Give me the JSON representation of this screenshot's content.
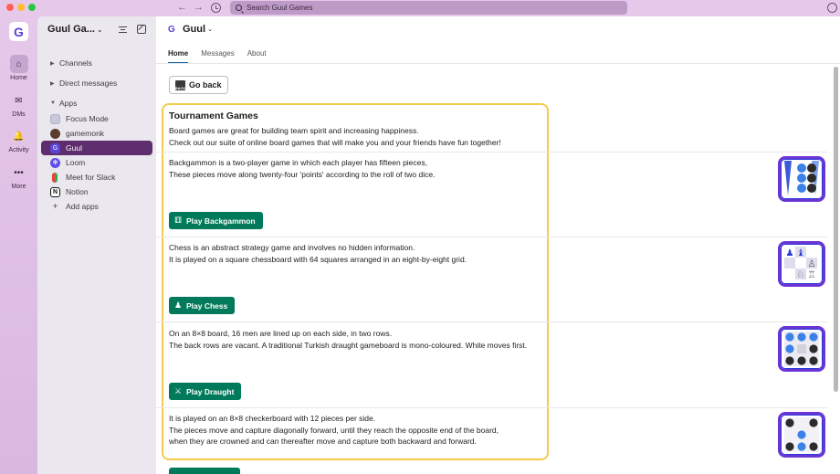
{
  "titlebar": {
    "search_placeholder": "Search Guul Games",
    "back_arrow": "←",
    "forward_arrow": "→"
  },
  "rail": {
    "workspace_initial": "G",
    "items": [
      {
        "label": "Home",
        "icon": "home-icon",
        "glyph": "⌂"
      },
      {
        "label": "DMs",
        "icon": "dms-icon",
        "glyph": "✉"
      },
      {
        "label": "Activity",
        "icon": "bell-icon",
        "glyph": "🔔"
      },
      {
        "label": "More",
        "icon": "more-icon",
        "glyph": "•••"
      }
    ]
  },
  "sidebar": {
    "workspace_name": "Guul Ga...",
    "sections": {
      "channels": "Channels",
      "direct_messages": "Direct messages",
      "apps": "Apps"
    },
    "apps": [
      {
        "label": "Focus Mode",
        "icon_color": "#c7c9d9",
        "glyph": ""
      },
      {
        "label": "gamemonk",
        "icon_color": "#5a3d2b",
        "glyph": ""
      },
      {
        "label": "Guul",
        "icon_color": "#5b43d6",
        "glyph": "G"
      },
      {
        "label": "Loom",
        "icon_color": "#5f4fe8",
        "glyph": "✻"
      },
      {
        "label": "Meet for Slack",
        "icon_color": "#ffffff",
        "glyph": ""
      },
      {
        "label": "Notion",
        "icon_color": "#ffffff",
        "glyph": "N"
      }
    ],
    "add_apps": "Add apps"
  },
  "channel": {
    "name": "Guul",
    "tabs": [
      "Home",
      "Messages",
      "About"
    ]
  },
  "content": {
    "back_label": "Go back",
    "back_icon_text": "BACK",
    "title": "Tournament Games",
    "intro": [
      "Board games are great for building team spirit and increasing happiness.",
      "Check out our suite of online board games that will make you and your friends have fun together!"
    ],
    "games": [
      {
        "lines": [
          "Backgammon is a two-player game in which each player has fifteen pieces,",
          "These pieces move along twenty-four 'points' according to the roll of two dice."
        ],
        "button": "Play Backgammon",
        "icon": "dice-icon"
      },
      {
        "lines": [
          "Chess is an abstract strategy game and involves no hidden information.",
          "It is played on a square chessboard with 64 squares arranged in an eight-by-eight grid."
        ],
        "button": "Play Chess",
        "icon": "chess-pawn-icon"
      },
      {
        "lines": [
          "On an 8×8 board, 16 men are lined up on each side, in two rows.",
          "The back rows are vacant. A traditional Turkish draught gameboard is mono-coloured. White moves first."
        ],
        "button": "Play Draught",
        "icon": "crossed-swords-icon"
      },
      {
        "lines": [
          "It is played on an 8×8 checkerboard with 12 pieces per side.",
          "The pieces move and capture diagonally forward, until they reach the opposite end of the board,",
          "when they are crowned and can thereafter move and capture both backward and forward."
        ]
      }
    ]
  },
  "colors": {
    "accent_green": "#007a5a",
    "selected_sidebar": "#5e2d6e",
    "highlight_border": "#f2cc4a",
    "thumb_border": "#6a34d6"
  }
}
